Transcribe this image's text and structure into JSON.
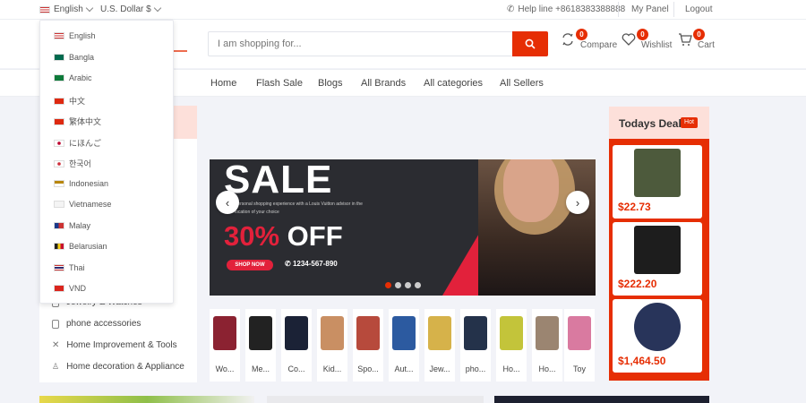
{
  "topbar": {
    "language": "English",
    "currency": "U.S. Dollar $",
    "help": "Help line +8618383388888",
    "my_panel": "My Panel",
    "logout": "Logout"
  },
  "header": {
    "search_placeholder": "I am shopping for...",
    "compare_label": "Compare",
    "compare_count": "0",
    "wishlist_label": "Wishlist",
    "wishlist_count": "0",
    "cart_label": "Cart",
    "cart_count": "0"
  },
  "nav": {
    "items": [
      "Home",
      "Flash Sale",
      "Blogs",
      "All Brands",
      "All categories",
      "All Sellers"
    ]
  },
  "languages": [
    "English",
    "Bangla",
    "Arabic",
    "中文",
    "繁体中文",
    "にほんご",
    "한국어",
    "Indonesian",
    "Vietnamese",
    "Malay",
    "Belarusian",
    "Thai",
    "VND"
  ],
  "categories": {
    "partial": "Jewelry & Watches",
    "items": [
      "phone accessories",
      "Home Improvement & Tools",
      "Home decoration & Appliance"
    ]
  },
  "banner": {
    "headline": "SALE",
    "subtext": "Personal shopping experience with a Louis Vuitton advisor in the location of your choice",
    "discount_num": "30%",
    "discount_word": "OFF",
    "shop_label": "SHOP NOW",
    "phone": "1234-567-890"
  },
  "thumbnails": [
    "Wo...",
    "Me...",
    "Co...",
    "Kid...",
    "Spo...",
    "Aut...",
    "Jew...",
    "pho...",
    "Ho...",
    "Ho...",
    "Toy"
  ],
  "deal": {
    "title": "Todays Deal",
    "hot": "Hot",
    "prices": [
      "$22.73",
      "$222.20",
      "$1,464.50"
    ]
  },
  "colors": {
    "accent": "#e62e04",
    "banner_red": "#e2213b"
  }
}
